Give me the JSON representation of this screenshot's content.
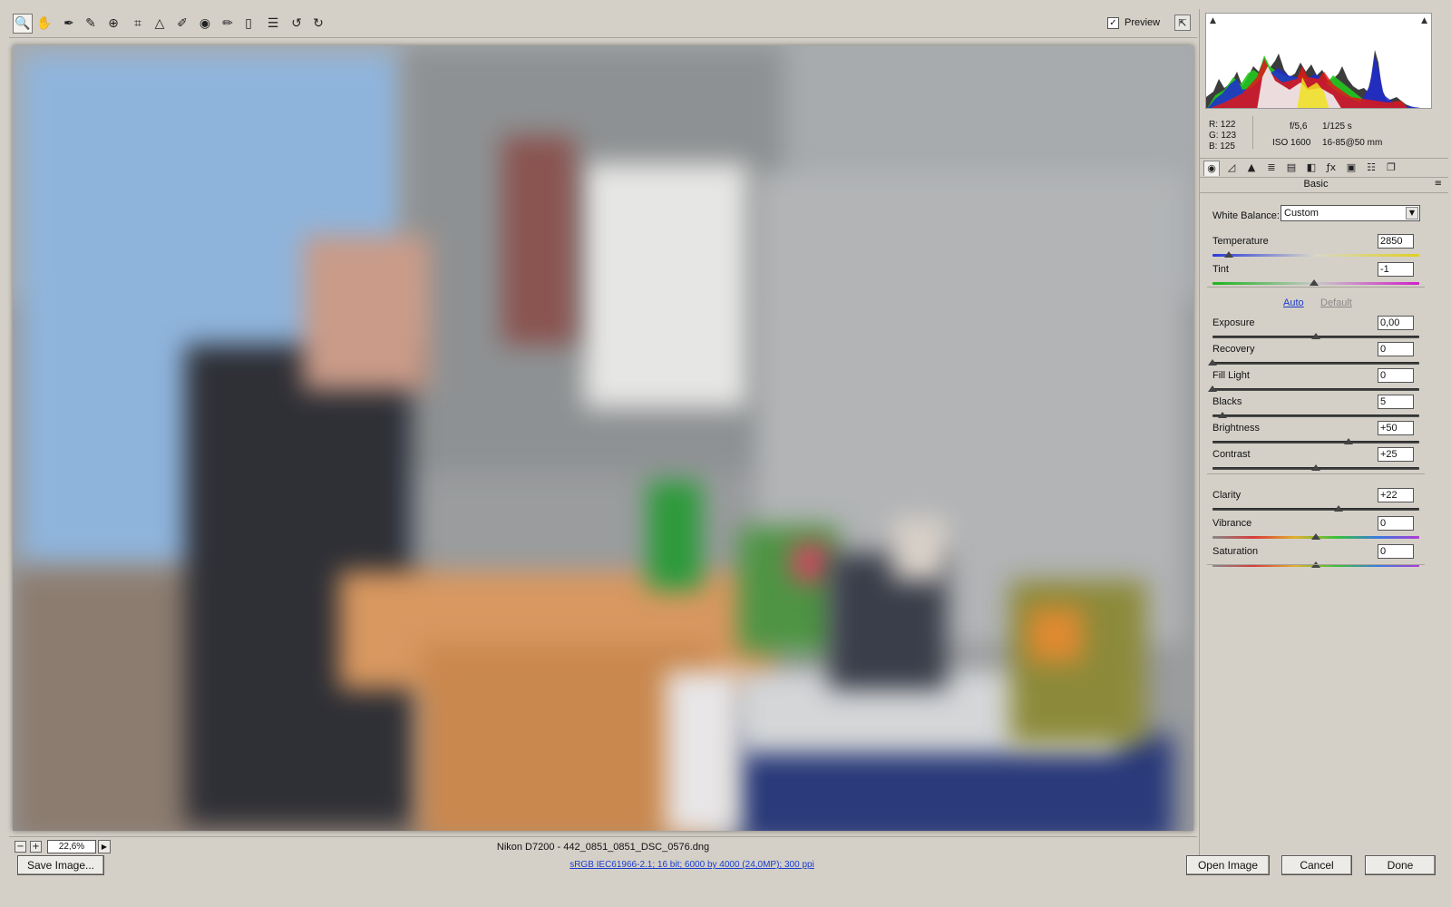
{
  "toolbar": {
    "tools": [
      {
        "name": "zoom-tool",
        "glyph": "🔍"
      },
      {
        "name": "hand-tool",
        "glyph": "✋"
      },
      {
        "name": "white-balance-tool",
        "glyph": "✒"
      },
      {
        "name": "color-sampler-tool",
        "glyph": "✎"
      },
      {
        "name": "targeted-adjustment-tool",
        "glyph": "⊕"
      },
      {
        "name": "crop-tool",
        "glyph": "⌗"
      },
      {
        "name": "straighten-tool",
        "glyph": "△"
      },
      {
        "name": "spot-removal-tool",
        "glyph": "✐"
      },
      {
        "name": "red-eye-tool",
        "glyph": "◉"
      },
      {
        "name": "adjustment-brush-tool",
        "glyph": "✏"
      },
      {
        "name": "graduated-filter-tool",
        "glyph": "▯"
      },
      {
        "name": "preferences-tool",
        "glyph": "☰"
      },
      {
        "name": "rotate-left-tool",
        "glyph": "↺"
      },
      {
        "name": "rotate-right-tool",
        "glyph": "↻"
      }
    ],
    "preview_checked": "✓",
    "preview_label": "Preview",
    "fullscreen_glyph": "⇱"
  },
  "status": {
    "zoom_out": "−",
    "zoom_in": "+",
    "zoom": "22,6%",
    "zoom_menu": "▶",
    "filename": "Nikon D7200  -  442_0851_0851_DSC_0576.dng"
  },
  "histogram": {
    "shadow_clip": "▲",
    "highlight_clip": "▲"
  },
  "info": {
    "r": "R:  122",
    "g": "G:  123",
    "b": "B:  125",
    "aperture": "f/5,6",
    "shutter": "1/125 s",
    "iso": "ISO 1600",
    "lens": "16-85@50 mm"
  },
  "tabs": [
    "◉",
    "◿",
    "▲",
    "≣",
    "▤",
    "◧",
    "ƒx",
    "▣",
    "☷",
    "❐"
  ],
  "panel": {
    "title": "Basic",
    "menu": "≡",
    "white_balance_label": "White Balance:",
    "white_balance_value": "Custom",
    "dropdown_glyph": "▼",
    "auto": "Auto",
    "default": "Default"
  },
  "sliders": [
    {
      "id": "temperature",
      "label": "Temperature",
      "value": "2850",
      "position": 0.08
    },
    {
      "id": "tint",
      "label": "Tint",
      "value": "-1",
      "position": 0.49
    },
    {
      "id": "exposure",
      "label": "Exposure",
      "value": "0,00",
      "position": 0.5
    },
    {
      "id": "recovery",
      "label": "Recovery",
      "value": "0",
      "position": 0.0
    },
    {
      "id": "fill-light",
      "label": "Fill Light",
      "value": "0",
      "position": 0.0
    },
    {
      "id": "blacks",
      "label": "Blacks",
      "value": "5",
      "position": 0.05
    },
    {
      "id": "brightness",
      "label": "Brightness",
      "value": "+50",
      "position": 0.66
    },
    {
      "id": "contrast",
      "label": "Contrast",
      "value": "+25",
      "position": 0.5
    },
    {
      "id": "clarity",
      "label": "Clarity",
      "value": "+22",
      "position": 0.61
    },
    {
      "id": "vibrance",
      "label": "Vibrance",
      "value": "0",
      "position": 0.5
    },
    {
      "id": "saturation",
      "label": "Saturation",
      "value": "0",
      "position": 0.5
    }
  ],
  "bottom": {
    "save": "Save Image...",
    "workflow": "sRGB IEC61966-2.1; 16 bit; 6000 by 4000 (24,0MP); 300 ppi",
    "open": "Open Image",
    "cancel": "Cancel",
    "done": "Done"
  }
}
